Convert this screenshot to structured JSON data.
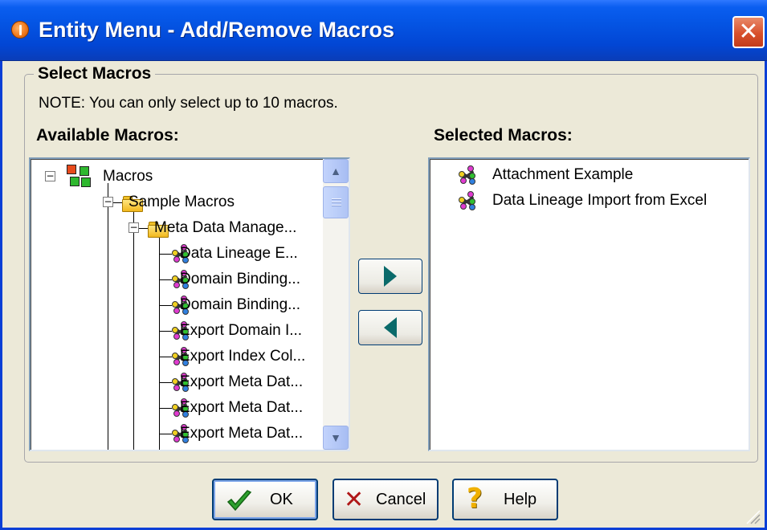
{
  "window": {
    "title": "Entity Menu - Add/Remove Macros",
    "close_symbol": "✕"
  },
  "group": {
    "title": "Select Macros",
    "note": "NOTE: You can only select up to 10 macros."
  },
  "available": {
    "label": "Available Macros:",
    "tree": [
      {
        "label": "Macros",
        "level": 0,
        "expander": "−",
        "icon": "macros-root-icon"
      },
      {
        "label": "Sample Macros",
        "level": 1,
        "expander": "−",
        "icon": "folder-icon"
      },
      {
        "label": "Meta Data Manage...",
        "level": 2,
        "expander": "−",
        "icon": "folder-icon"
      },
      {
        "label": "Data Lineage E...",
        "level": 3,
        "icon": "macro-icon"
      },
      {
        "label": "Domain Binding...",
        "level": 3,
        "icon": "macro-icon"
      },
      {
        "label": "Domain Binding...",
        "level": 3,
        "icon": "macro-icon"
      },
      {
        "label": "Export Domain I...",
        "level": 3,
        "icon": "macro-icon"
      },
      {
        "label": "Export Index Col...",
        "level": 3,
        "icon": "macro-icon"
      },
      {
        "label": "Export Meta Dat...",
        "level": 3,
        "icon": "macro-icon"
      },
      {
        "label": "Export Meta Dat...",
        "level": 3,
        "icon": "macro-icon"
      },
      {
        "label": "Export Meta Dat...",
        "level": 3,
        "icon": "macro-icon"
      }
    ]
  },
  "selected": {
    "label": "Selected Macros:",
    "items": [
      {
        "label": "Attachment Example",
        "icon": "macro-icon"
      },
      {
        "label": "Data Lineage Import from Excel",
        "icon": "macro-icon"
      }
    ]
  },
  "buttons": {
    "ok": "OK",
    "cancel": "Cancel",
    "help": "Help"
  },
  "colors": {
    "titlebar": "#0454e3",
    "dialog_bg": "#ece9d8",
    "arrow": "#0a6a6a"
  }
}
